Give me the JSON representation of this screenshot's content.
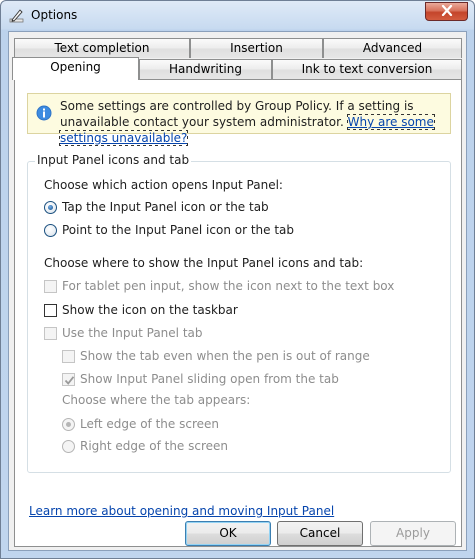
{
  "window": {
    "title": "Options",
    "close_glyph": "✕",
    "title_icon": "pen-options-icon"
  },
  "tabs": {
    "row1": [
      "Text completion",
      "Insertion",
      "Advanced"
    ],
    "row2": [
      "Opening",
      "Handwriting",
      "Ink to text conversion"
    ],
    "active": "Opening"
  },
  "info": {
    "icon": "info-icon",
    "text": "Some settings are controlled by Group Policy. If a setting is unavailable contact your system administrator. ",
    "link": "Why are some settings unavailable?"
  },
  "group": {
    "title": "Input Panel icons and tab",
    "action_prompt": "Choose which action opens Input Panel:",
    "action_options": [
      {
        "label": "Tap the Input Panel icon or the tab",
        "checked": true
      },
      {
        "label": "Point to the Input Panel icon or the tab",
        "checked": false
      }
    ],
    "where_prompt": "Choose where to show the Input Panel icons and tab:",
    "tablet_pen": {
      "label": "For tablet pen input, show the icon next to the text box",
      "checked": false,
      "disabled": true
    },
    "taskbar": {
      "label": "Show the icon on the taskbar",
      "checked": false,
      "disabled": false
    },
    "use_tab": {
      "label": "Use the Input Panel tab",
      "checked": false,
      "disabled": true
    },
    "show_out_of_range": {
      "label": "Show the tab even when the pen is out of range",
      "checked": false,
      "disabled": true
    },
    "sliding_open": {
      "label": "Show Input Panel sliding open from the tab",
      "checked": true,
      "disabled": true
    },
    "tab_appears_prompt": "Choose where the tab appears:",
    "tab_position_options": [
      {
        "label": "Left edge of the screen",
        "checked": true,
        "disabled": true
      },
      {
        "label": "Right edge of the screen",
        "checked": false,
        "disabled": true
      }
    ]
  },
  "learn_more": "Learn more about opening and moving Input Panel",
  "buttons": {
    "ok": "OK",
    "cancel": "Cancel",
    "apply": "Apply"
  },
  "colors": {
    "link": "#0645ad",
    "info_background": "#fdfbe0",
    "disabled_text": "#8d8d8d",
    "close_button": "#c4452b"
  }
}
